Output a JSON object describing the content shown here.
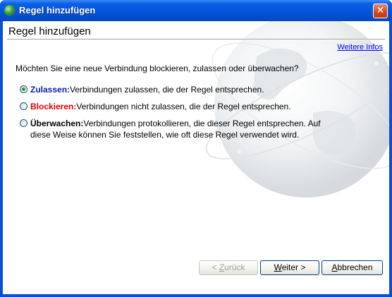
{
  "window": {
    "title": "Regel hinzufügen",
    "close_glyph": "✕"
  },
  "header": {
    "title": "Regel hinzufügen",
    "more_info_link": "Weitere Infos"
  },
  "question": "Möchten Sie eine neue Verbindung blockieren, zulassen oder überwachen?",
  "options": [
    {
      "keyword": "Zulassen:",
      "description": "Verbindungen zulassen, die der Regel entsprechen.",
      "selected": true,
      "keyword_color": "#0a1fa8"
    },
    {
      "keyword": "Blockieren:",
      "description": "Verbindungen nicht zulassen, die der Regel entsprechen.",
      "selected": false,
      "keyword_color": "#e00000"
    },
    {
      "keyword": "Überwachen:",
      "description_line1": "Verbindungen protokollieren, die dieser Regel entsprechen. Auf",
      "description_line2": "diese Weise können Sie feststellen, wie oft diese Regel verwendet wird.",
      "selected": false,
      "keyword_color": "#000000"
    }
  ],
  "buttons": {
    "back_prefix": "< ",
    "back_mnemonic": "Z",
    "back_rest": "urück",
    "next_mnemonic": "W",
    "next_rest": "eiter >",
    "cancel_mnemonic": "A",
    "cancel_rest": "bbrechen"
  },
  "icons": {
    "title_icon": "globe-icon",
    "close": "close-icon"
  }
}
